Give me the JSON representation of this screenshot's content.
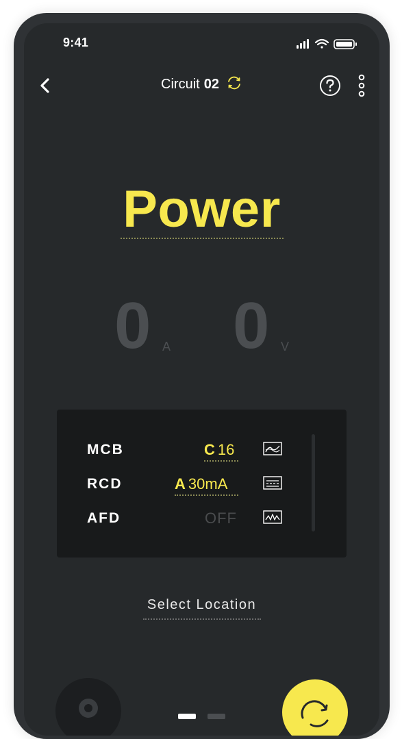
{
  "status_bar": {
    "time": "9:41"
  },
  "header": {
    "title": "Circuit",
    "circuit_number": "02"
  },
  "main": {
    "mode": "Power",
    "current": {
      "value": "0",
      "unit": "A"
    },
    "voltage": {
      "value": "0",
      "unit": "V"
    }
  },
  "protection": {
    "rows": [
      {
        "label": "MCB",
        "prefix": "C",
        "value": "16",
        "icon": "curve-icon"
      },
      {
        "label": "RCD",
        "prefix": "A",
        "value": "30mA",
        "icon": "waveform-icon"
      },
      {
        "label": "AFD",
        "value": "OFF",
        "icon": "arc-icon"
      }
    ]
  },
  "location": {
    "label": "Select Location"
  },
  "colors": {
    "accent": "#f7e84e",
    "background": "#26292b",
    "panel": "#181a1b"
  }
}
